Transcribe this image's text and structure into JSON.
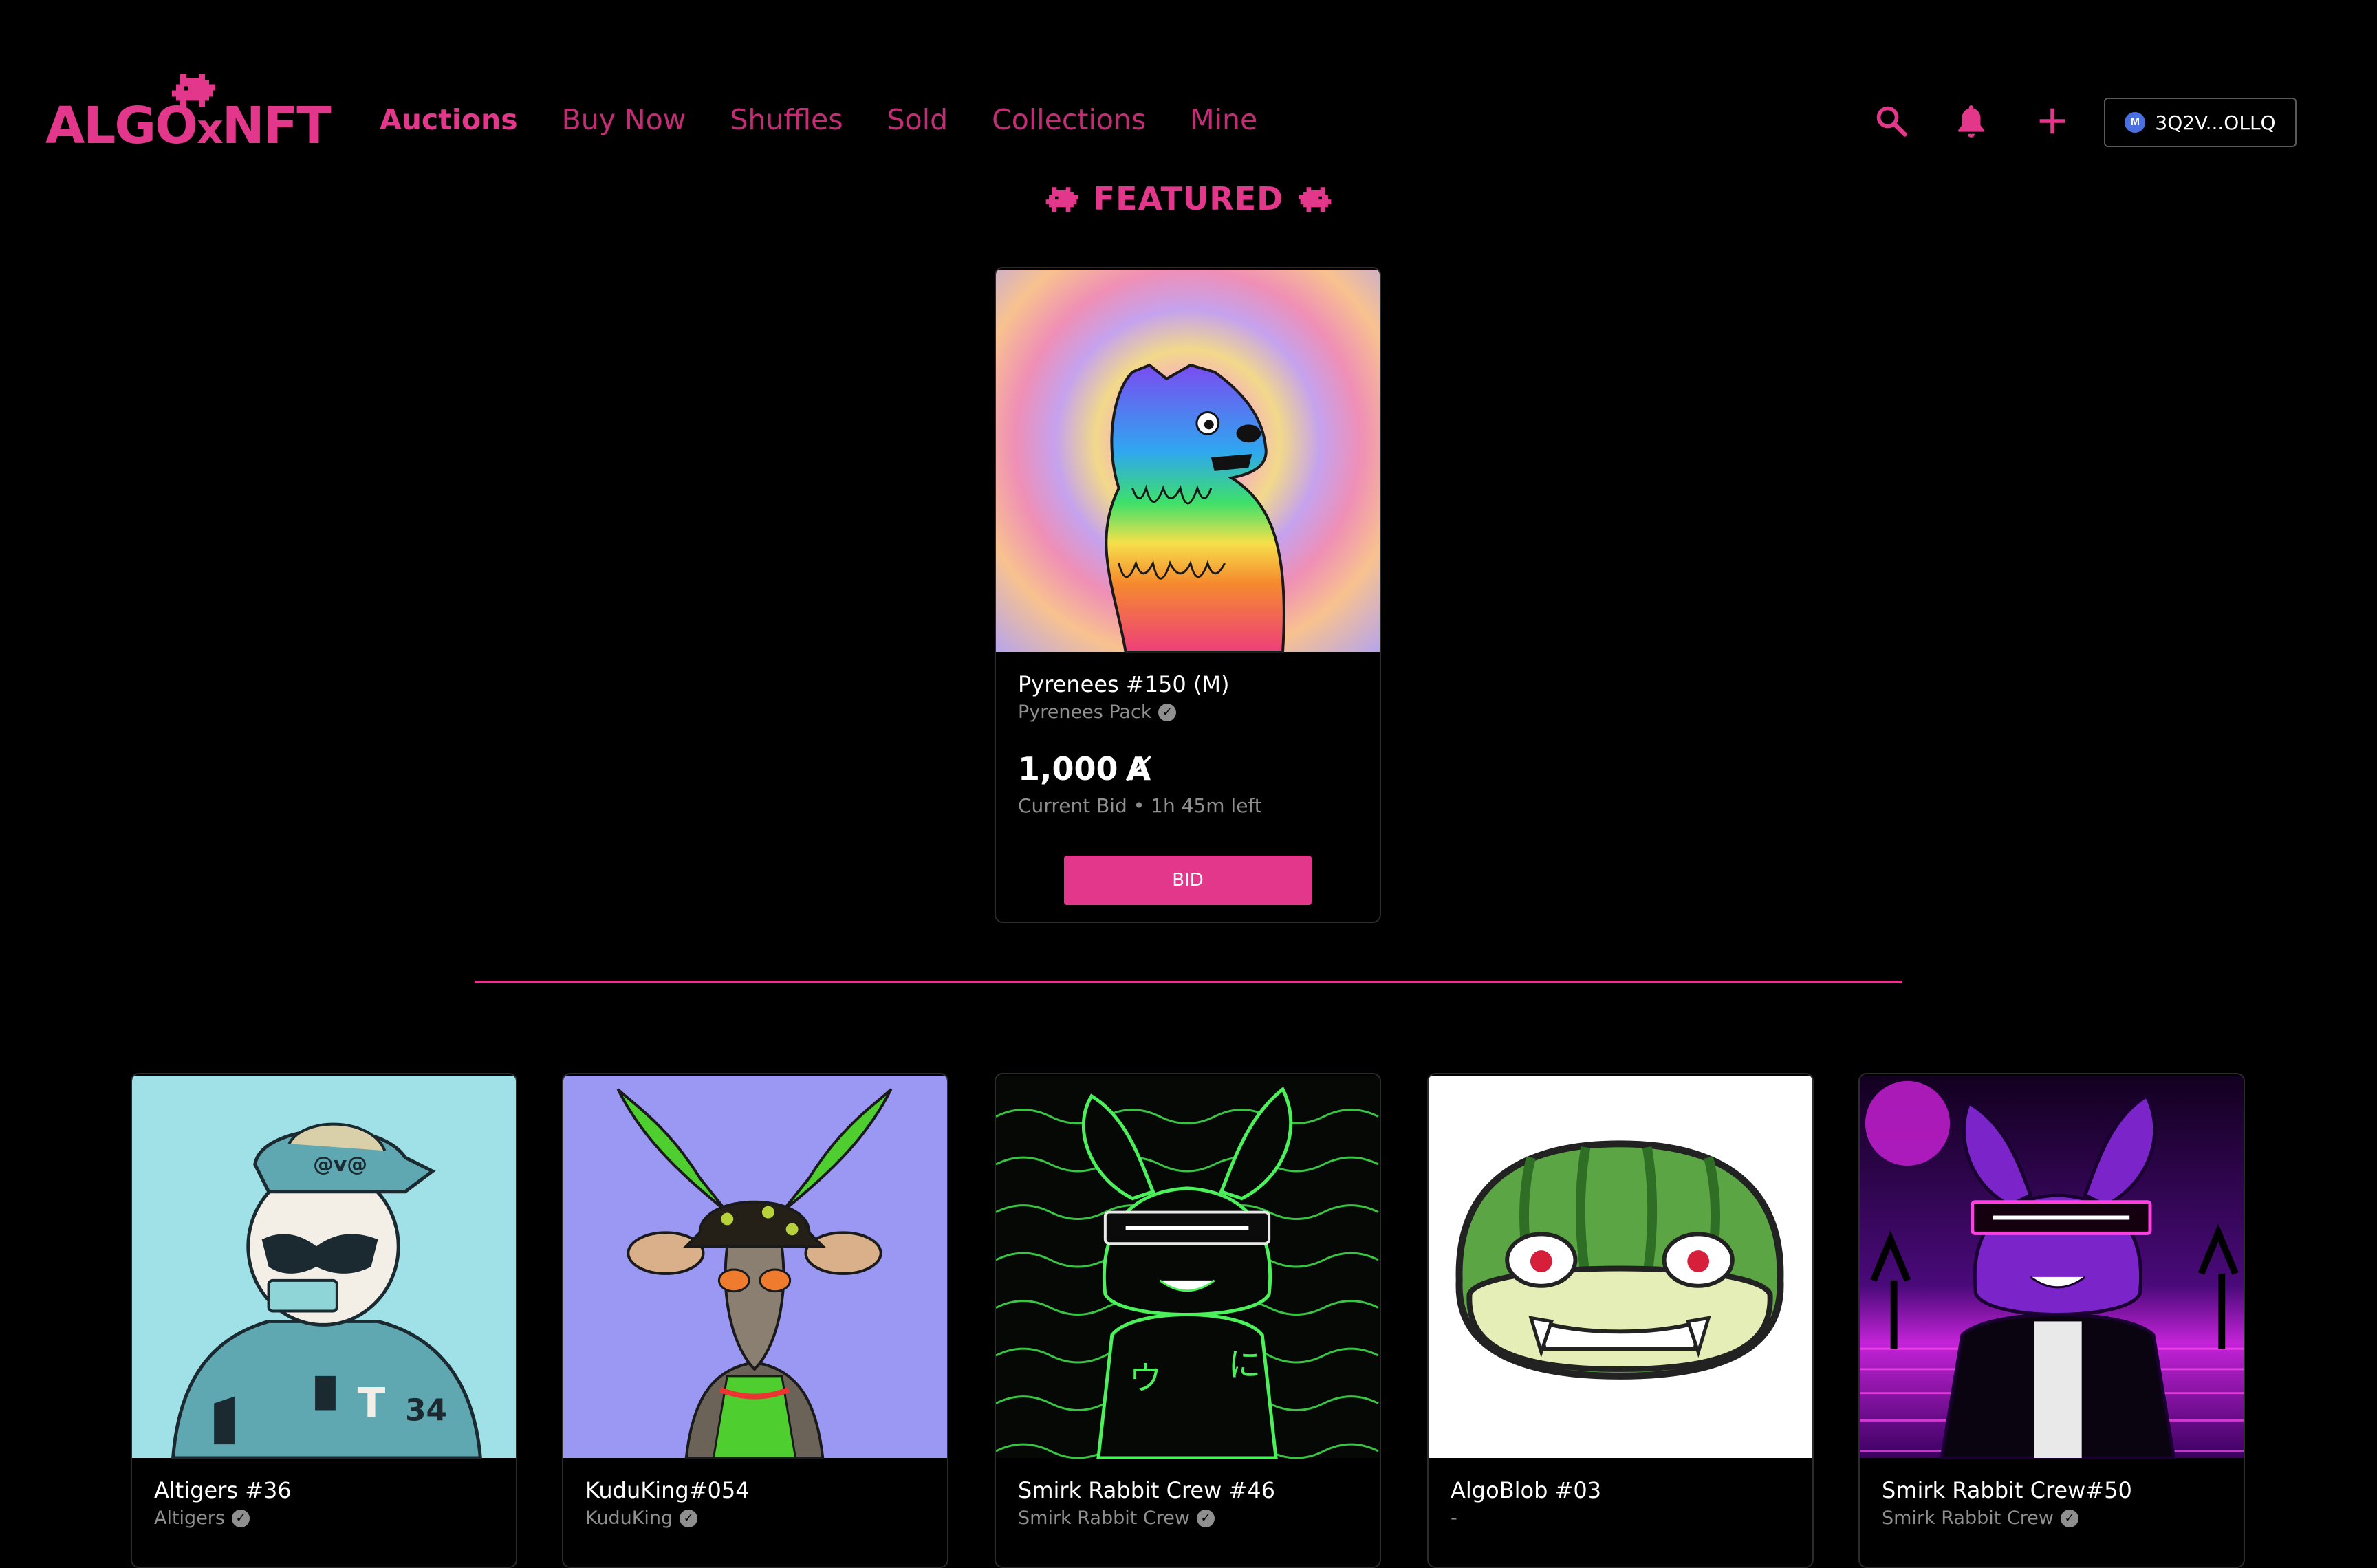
{
  "header": {
    "logo_main": "ALGO",
    "logo_x": "x",
    "logo_tail": "NFT",
    "nav": [
      {
        "label": "Auctions",
        "active": true
      },
      {
        "label": "Buy Now",
        "active": false
      },
      {
        "label": "Shuffles",
        "active": false
      },
      {
        "label": "Sold",
        "active": false
      },
      {
        "label": "Collections",
        "active": false
      },
      {
        "label": "Mine",
        "active": false
      }
    ],
    "icons": [
      "search-icon",
      "bell-icon",
      "plus-icon"
    ],
    "wallet": {
      "icon_letter": "M",
      "address": "3Q2V...OLLQ"
    }
  },
  "colors": {
    "accent": "#e2378b",
    "nav_inactive": "#c42c76",
    "background": "#000000",
    "muted_text": "#8f8f8f"
  },
  "featured": {
    "heading": "FEATURED",
    "card": {
      "title": "Pyrenees #150 (M)",
      "collection": "Pyrenees Pack",
      "price": "1,000",
      "currency_symbol": "Ⱥ",
      "meta": "Current Bid • 1h 45m left",
      "button": "BID"
    }
  },
  "listings": [
    {
      "title": "Altigers #36",
      "collection": "Altigers",
      "verified": true
    },
    {
      "title": "KuduKing#054",
      "collection": "KuduKing",
      "verified": true
    },
    {
      "title": "Smirk Rabbit Crew #46",
      "collection": "Smirk Rabbit Crew",
      "verified": true
    },
    {
      "title": "AlgoBlob #03",
      "collection": "-",
      "verified": false
    },
    {
      "title": "Smirk Rabbit Crew#50",
      "collection": "Smirk Rabbit Crew",
      "verified": true
    }
  ]
}
